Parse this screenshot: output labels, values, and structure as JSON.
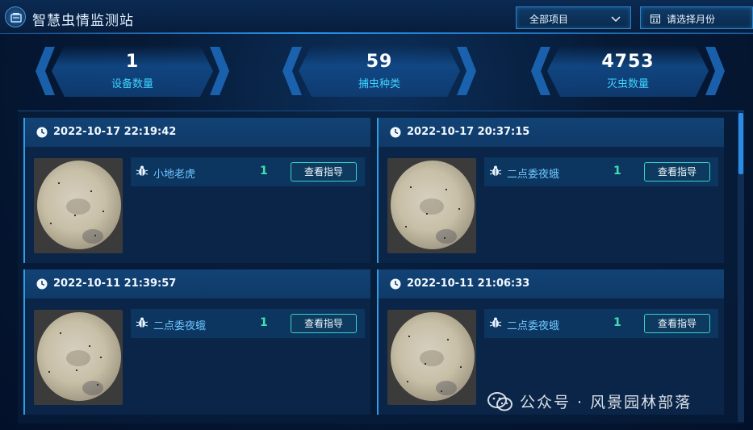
{
  "app": {
    "title": "智慧虫情监测站"
  },
  "filters": {
    "project": {
      "selected": "全部项目"
    },
    "month": {
      "placeholder": "请选择月份"
    }
  },
  "stats": [
    {
      "value": "1",
      "label": "设备数量"
    },
    {
      "value": "59",
      "label": "捕虫种类"
    },
    {
      "value": "4753",
      "label": "灭虫数量"
    }
  ],
  "records": [
    {
      "time": "2022-10-17 22:19:42",
      "pest": "小地老虎",
      "count": "1",
      "action": "查看指导"
    },
    {
      "time": "2022-10-17 20:37:15",
      "pest": "二点委夜蛾",
      "count": "1",
      "action": "查看指导"
    },
    {
      "time": "2022-10-11 21:39:57",
      "pest": "二点委夜蛾",
      "count": "1",
      "action": "查看指导"
    },
    {
      "time": "2022-10-11 21:06:33",
      "pest": "二点委夜蛾",
      "count": "1",
      "action": "查看指导"
    }
  ],
  "watermark": {
    "text": "公众号 · 风景园林部落"
  },
  "icons": {
    "logo": "station-logo-icon",
    "dropdown": "chevron-down-icon",
    "calendar": "calendar-icon",
    "clock": "clock-icon",
    "pest": "bug-icon",
    "wechat": "wechat-icon"
  },
  "colors": {
    "accent": "#2a8ce6",
    "stat_label": "#3fd3ff",
    "count": "#3ee0b1",
    "pest_name": "#6fc6ff",
    "button_border": "#3ad3c4"
  }
}
